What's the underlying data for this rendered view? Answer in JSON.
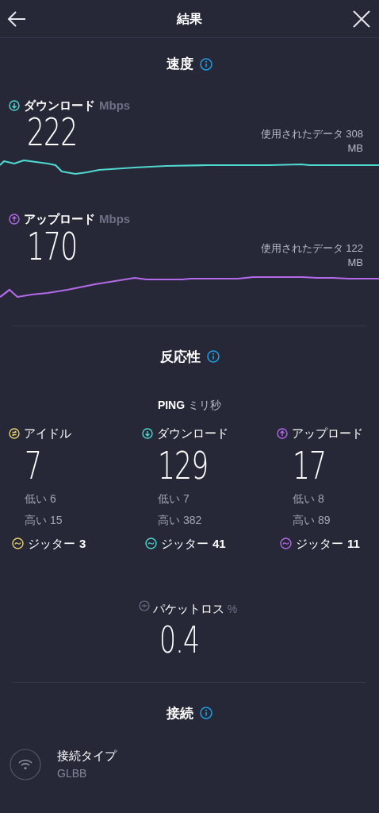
{
  "header": {
    "title": "結果"
  },
  "speed": {
    "title": "速度",
    "items": [
      {
        "kind": "download",
        "label": "ダウンロード",
        "unit": "Mbps",
        "value": "222",
        "data_label": "使用されたデータ 308",
        "data_unit": "MB",
        "color": "#4fd8d0"
      },
      {
        "kind": "upload",
        "label": "アップロード",
        "unit": "Mbps",
        "value": "170",
        "data_label": "使用されたデータ 122",
        "data_unit": "MB",
        "color": "#b46ae8"
      }
    ]
  },
  "responsiveness": {
    "title": "反応性",
    "ping_label": "PING",
    "ping_unit": "ミリ秒",
    "columns": [
      {
        "kind": "idle",
        "label": "アイドル",
        "value": "7",
        "low": "低い 6",
        "high": "高い 15",
        "jitter": "ジッター",
        "jitter_value": "3",
        "color": "#e8d36a"
      },
      {
        "kind": "download",
        "label": "ダウンロード",
        "value": "129",
        "low": "低い 7",
        "high": "高い 382",
        "jitter": "ジッター",
        "jitter_value": "41",
        "color": "#4fd8d0"
      },
      {
        "kind": "upload",
        "label": "アップロード",
        "value": "17",
        "low": "低い 8",
        "high": "高い 89",
        "jitter": "ジッター",
        "jitter_value": "11",
        "color": "#b46ae8"
      }
    ],
    "packet_loss": {
      "label": "パケットロス",
      "unit": "%",
      "value": "0.4"
    }
  },
  "connection": {
    "title": "接続",
    "items": [
      {
        "label": "接続タイプ",
        "value": "GLBB"
      }
    ]
  }
}
